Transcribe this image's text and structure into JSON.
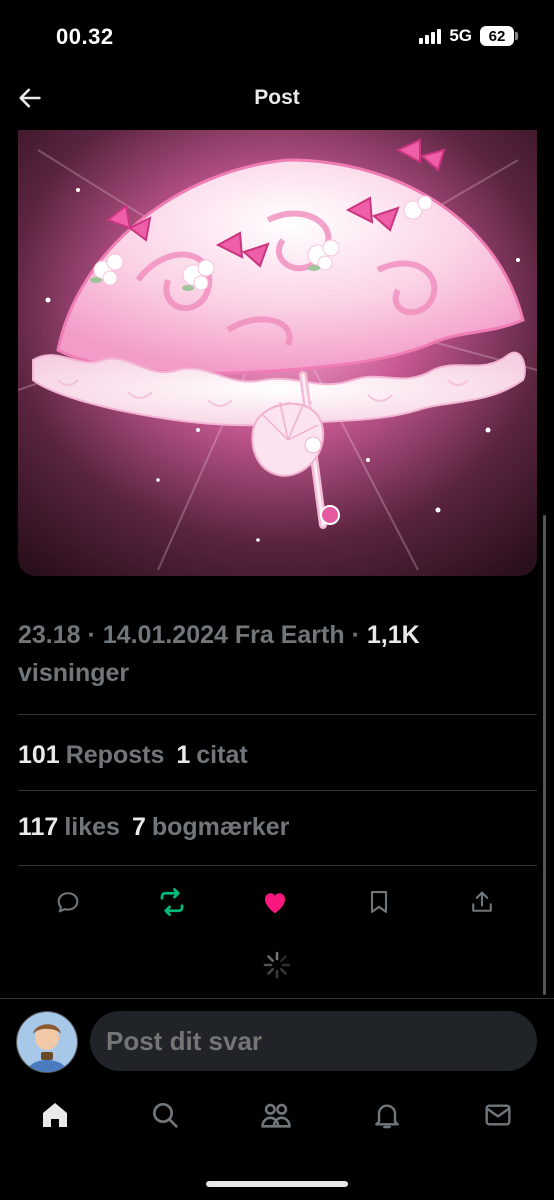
{
  "status_bar": {
    "time": "00.32",
    "network": "5G",
    "battery": "62"
  },
  "header": {
    "title": "Post",
    "back_icon": "arrow-left-icon"
  },
  "media": {
    "palette": [
      "#f7a8d0",
      "#e35aa0",
      "#3a1828"
    ]
  },
  "post_meta": {
    "time": "23.18",
    "date": "14.01.2024",
    "source": "Fra Earth",
    "views_count": "1,1K",
    "views_label": "visninger"
  },
  "stats": {
    "reposts_count": "101",
    "reposts_label": "Reposts",
    "quotes_count": "1",
    "quotes_label": "citat",
    "likes_count": "117",
    "likes_label": "likes",
    "bookmarks_count": "7",
    "bookmarks_label": "bogmærker"
  },
  "actions": {
    "icons": [
      "reply-icon",
      "repost-icon",
      "like-icon",
      "bookmark-icon",
      "share-icon"
    ],
    "repost_color": "#00ba7c",
    "like_color": "#f91880"
  },
  "reply": {
    "placeholder": "Post dit svar"
  },
  "tab_bar": {
    "icons": [
      "home-icon",
      "search-icon",
      "communities-icon",
      "notifications-icon",
      "messages-icon"
    ]
  }
}
